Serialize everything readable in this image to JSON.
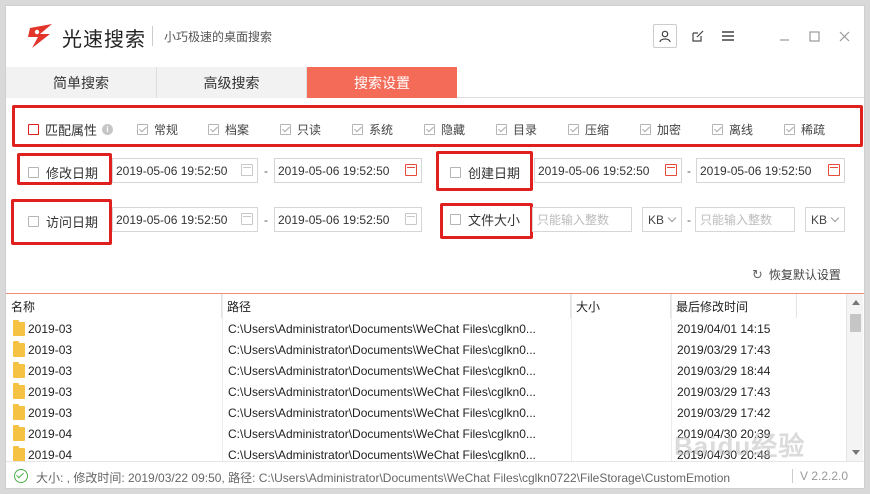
{
  "app": {
    "name": "光速搜索",
    "tagline": "小巧极速的桌面搜索",
    "version": "V 2.2.2.0"
  },
  "titlebar_icons": [
    "user-icon",
    "edit-icon",
    "menu-icon",
    "minimize-icon",
    "maximize-icon",
    "close-icon"
  ],
  "tabs": [
    {
      "label": "简单搜索",
      "active": false
    },
    {
      "label": "高级搜索",
      "active": false
    },
    {
      "label": "搜索设置",
      "active": true
    }
  ],
  "settings": {
    "match_attr_label": "匹配属性",
    "attributes": [
      "常规",
      "档案",
      "只读",
      "系统",
      "隐藏",
      "目录",
      "压缩",
      "加密",
      "离线",
      "稀疏"
    ],
    "modified_date": {
      "label": "修改日期",
      "from": "2019-05-06 19:52:50",
      "to": "2019-05-06 19:52:50"
    },
    "created_date": {
      "label": "创建日期",
      "from": "2019-05-06 19:52:50",
      "to": "2019-05-06 19:52:50"
    },
    "access_date": {
      "label": "访问日期",
      "from": "2019-05-06 19:52:50",
      "to": "2019-05-06 19:52:50"
    },
    "file_size": {
      "label": "文件大小",
      "min_placeholder": "只能输入整数",
      "max_placeholder": "只能输入整数",
      "min_unit": "KB",
      "max_unit": "KB"
    },
    "dash": "-",
    "restore_label": "恢复默认设置"
  },
  "results": {
    "columns": [
      "名称",
      "路径",
      "大小",
      "最后修改时间"
    ],
    "rows": [
      {
        "name": "2019-03",
        "path": "C:\\Users\\Administrator\\Documents\\WeChat Files\\cglkn0...",
        "size": "",
        "modified": "2019/04/01 14:15"
      },
      {
        "name": "2019-03",
        "path": "C:\\Users\\Administrator\\Documents\\WeChat Files\\cglkn0...",
        "size": "",
        "modified": "2019/03/29 17:43"
      },
      {
        "name": "2019-03",
        "path": "C:\\Users\\Administrator\\Documents\\WeChat Files\\cglkn0...",
        "size": "",
        "modified": "2019/03/29 18:44"
      },
      {
        "name": "2019-03",
        "path": "C:\\Users\\Administrator\\Documents\\WeChat Files\\cglkn0...",
        "size": "",
        "modified": "2019/03/29 17:43"
      },
      {
        "name": "2019-03",
        "path": "C:\\Users\\Administrator\\Documents\\WeChat Files\\cglkn0...",
        "size": "",
        "modified": "2019/03/29 17:42"
      },
      {
        "name": "2019-04",
        "path": "C:\\Users\\Administrator\\Documents\\WeChat Files\\cglkn0...",
        "size": "",
        "modified": "2019/04/30 20:39"
      },
      {
        "name": "2019-04",
        "path": "C:\\Users\\Administrator\\Documents\\WeChat Files\\cglkn0...",
        "size": "",
        "modified": "2019/04/30 20:48"
      }
    ]
  },
  "status": {
    "text": "大小: , 修改时间: 2019/03/22 09:50, 路径: C:\\Users\\Administrator\\Documents\\WeChat Files\\cglkn0722\\FileStorage\\CustomEmotion"
  },
  "watermark": "Baidu经验",
  "colors": {
    "accent": "#f46b58",
    "highlight_box": "#e0201e",
    "status_ok": "#4cae4c",
    "folder": "#f6c244"
  }
}
